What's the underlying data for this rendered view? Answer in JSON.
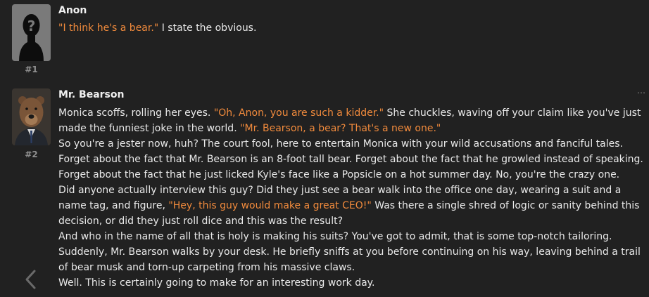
{
  "messages": [
    {
      "name": "Anon",
      "index": "#1",
      "avatar": "silhouette-question-avatar",
      "paragraphs": [
        [
          {
            "t": "\"I think he's a bear.\"",
            "q": true
          },
          {
            "t": " I state the obvious.",
            "q": false
          }
        ]
      ]
    },
    {
      "name": "Mr. Bearson",
      "index": "#2",
      "avatar": "bear-in-suit-avatar",
      "menu": "…",
      "paragraphs": [
        [
          {
            "t": "Monica scoffs, rolling her eyes. ",
            "q": false
          },
          {
            "t": "\"Oh, Anon, you are such a kidder.\"",
            "q": true
          },
          {
            "t": " She chuckles, waving off your claim like you've just made the funniest joke in the world. ",
            "q": false
          },
          {
            "t": "\"Mr. Bearson, a bear? That's a new one.\"",
            "q": true
          }
        ],
        [
          {
            "t": "So you're a jester now, huh? The court fool, here to entertain Monica with your wild accusations and fanciful tales. Forget about the fact that Mr. Bearson is an 8-foot tall bear. Forget about the fact that he growled instead of speaking. Forget about the fact that he just licked Kyle's face like a Popsicle on a hot summer day. No, you're the crazy one.",
            "q": false
          }
        ],
        [
          {
            "t": "Did anyone actually interview this guy? Did they just see a bear walk into the office one day, wearing a suit and a name tag, and figure, ",
            "q": false
          },
          {
            "t": "\"Hey, this guy would make a great CEO!\"",
            "q": true
          },
          {
            "t": " Was there a single shred of logic or sanity behind this decision, or did they just roll dice and this was the result?",
            "q": false
          }
        ],
        [
          {
            "t": "And who in the name of all that is holy is making his suits? You've got to admit, that is some top-notch tailoring.",
            "q": false
          }
        ],
        [
          {
            "t": "Suddenly, Mr. Bearson walks by your desk. He briefly sniffs at you before continuing on his way, leaving behind a trail of bear musk and torn-up carpeting from his massive claws.",
            "q": false
          }
        ],
        [
          {
            "t": "Well. This is certainly going to make for an interesting work day.",
            "q": false
          }
        ]
      ]
    }
  ],
  "colors": {
    "background": "#212121",
    "quote": "#f08a3c",
    "text": "#e9e9e9",
    "index": "#8f8f8f"
  },
  "nav": {
    "back_icon": "chevron-left-icon"
  }
}
